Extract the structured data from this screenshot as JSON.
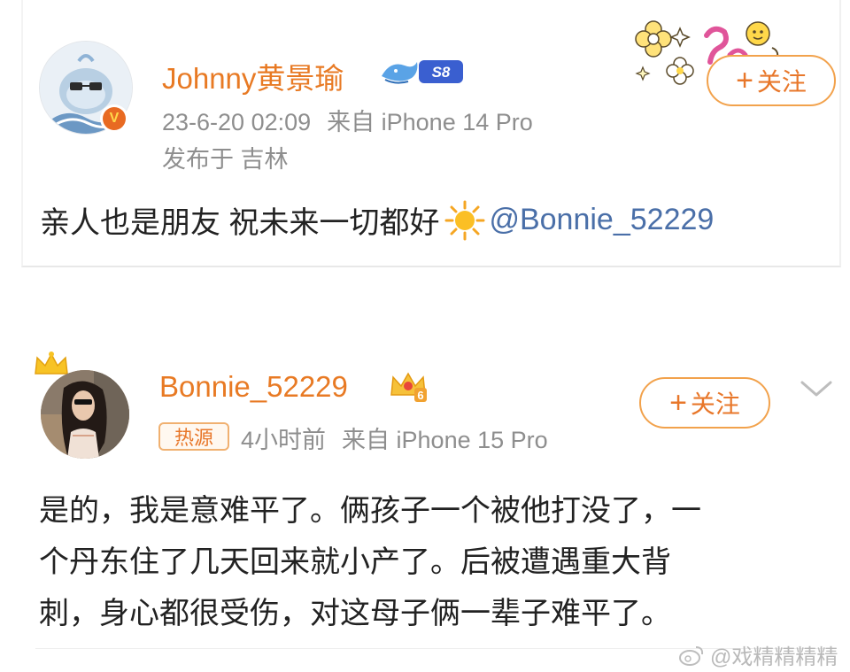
{
  "post1": {
    "username": "Johnny黄景瑜",
    "level_badge": "S8",
    "timestamp": "23-6-20 02:09",
    "source": "来自 iPhone 14 Pro",
    "location": "发布于 吉林",
    "content_text": "亲人也是朋友 祝未来一切都好",
    "mention": "@Bonnie_52229",
    "follow_label": "关注",
    "verified_badge": "V"
  },
  "post2": {
    "username": "Bonnie_52229",
    "vip_level": "6",
    "hot_tag": "热源",
    "time_ago": "4小时前",
    "source": "来自 iPhone 15 Pro",
    "content_lines": [
      "是的，我是意难平了。俩孩子一个被他打没了，一",
      "个丹东住了几天回来就小产了。后被遭遇重大背",
      "刺，身心都很受伤，对这母子俩一辈子难平了。"
    ],
    "follow_label": "关注"
  },
  "watermark": "@戏精精精精",
  "colors": {
    "username": "#e87a24",
    "meta": "#8e8e8e",
    "mention": "#4a6fa8",
    "follow_border": "#f2a24c"
  },
  "icons": [
    "sun-icon",
    "whale-badge-icon",
    "crown-icon",
    "chevron-down-icon",
    "weibo-icon",
    "verified-v-icon"
  ]
}
